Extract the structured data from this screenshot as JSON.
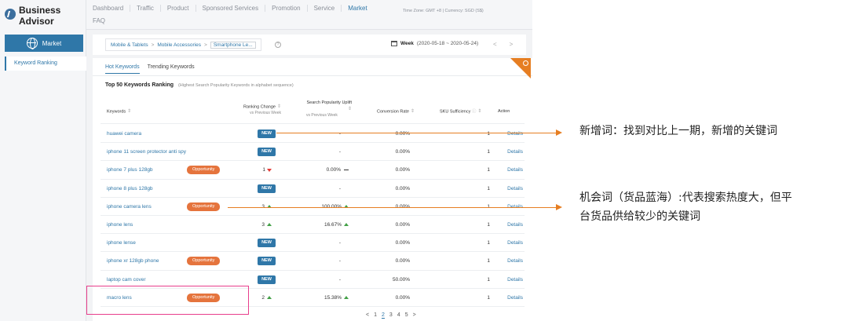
{
  "brand": {
    "title": "Business Advisor"
  },
  "sidebar": {
    "market_label": "Market",
    "items": [
      {
        "label": "Keyword Ranking"
      }
    ]
  },
  "topnav": {
    "items": [
      "Dashboard",
      "Traffic",
      "Product",
      "Sponsored Services",
      "Promotion",
      "Service",
      "Market"
    ],
    "faq": "FAQ",
    "active": "Market",
    "timezone": "Time Zone: GMT +8 | Currency: SGD (S$)"
  },
  "breadcrumb": {
    "items": [
      "Mobile & Tablets",
      "Mobile Accessories",
      "Smartphone Le..."
    ],
    "separator": ">"
  },
  "period": {
    "label": "Week",
    "range": "(2020-05-18 ~ 2020-05-24)",
    "prev": "<",
    "next": ">"
  },
  "tabs": [
    "Hot Keywords",
    "Trending Keywords"
  ],
  "section": {
    "title": "Top 50 Keywords Ranking",
    "subtitle": "(Highest Search Popularity Keywords in alphabet sequence)"
  },
  "columns": {
    "keywords": "Keywords",
    "ranking_change": "Ranking Change",
    "ranking_change_sub": "vs Previous Week",
    "popularity": "Search Popularity Uplift",
    "popularity_sub": "vs Previous Week",
    "conversion": "Conversion Rate",
    "sku": "SKU Sufficiency",
    "action": "Action"
  },
  "rows": [
    {
      "keyword": "huawei camera",
      "badge": "",
      "rank": "",
      "rank_new": "NEW",
      "popularity": "-",
      "conversion": "0.00%",
      "sku": "1",
      "action": "Details"
    },
    {
      "keyword": "iphone 11 screen protector anti spy",
      "badge": "",
      "rank": "",
      "rank_new": "NEW",
      "popularity": "-",
      "conversion": "0.00%",
      "sku": "1",
      "action": "Details"
    },
    {
      "keyword": "iphone 7 plus 128gb",
      "badge": "Opportunity",
      "rank": "1",
      "rank_new": "",
      "popularity": "0.00%",
      "conversion": "0.00%",
      "sku": "1",
      "action": "Details"
    },
    {
      "keyword": "iphone 8 plus 128gb",
      "badge": "",
      "rank": "",
      "rank_new": "NEW",
      "popularity": "-",
      "conversion": "0.00%",
      "sku": "1",
      "action": "Details"
    },
    {
      "keyword": "iphone camera lens",
      "badge": "Opportunity",
      "rank": "3",
      "rank_new": "",
      "popularity": "100.00%",
      "conversion": "0.00%",
      "sku": "1",
      "action": "Details"
    },
    {
      "keyword": "iphone lens",
      "badge": "",
      "rank": "3",
      "rank_new": "",
      "popularity": "16.67%",
      "conversion": "0.00%",
      "sku": "1",
      "action": "Details"
    },
    {
      "keyword": "iphone lense",
      "badge": "",
      "rank": "",
      "rank_new": "NEW",
      "popularity": "-",
      "conversion": "0.00%",
      "sku": "1",
      "action": "Details"
    },
    {
      "keyword": "iphone xr 128gb phone",
      "badge": "Opportunity",
      "rank": "",
      "rank_new": "NEW",
      "popularity": "-",
      "conversion": "0.00%",
      "sku": "1",
      "action": "Details"
    },
    {
      "keyword": "laptop cam cover",
      "badge": "",
      "rank": "",
      "rank_new": "NEW",
      "popularity": "-",
      "conversion": "50.00%",
      "sku": "1",
      "action": "Details"
    },
    {
      "keyword": "macro lens",
      "badge": "Opportunity",
      "rank": "2",
      "rank_new": "",
      "popularity": "15.38%",
      "conversion": "0.00%",
      "sku": "1",
      "action": "Details"
    }
  ],
  "pager": {
    "prev": "<",
    "pages": [
      "1",
      "2",
      "3",
      "4",
      "5"
    ],
    "current": "2",
    "next": ">"
  },
  "annotations": {
    "new_words": "新增词：找到对比上一期，新增的关键词",
    "opportunity_words_line1": "机会词（货品蓝海）:代表搜索热度大，但平",
    "opportunity_words_line2": "台货品供给较少的关键词"
  },
  "colors": {
    "accent": "#2f77a8",
    "opportunity": "#e5743d",
    "arrow": "#e67e22",
    "highlight": "#e83e8c"
  }
}
